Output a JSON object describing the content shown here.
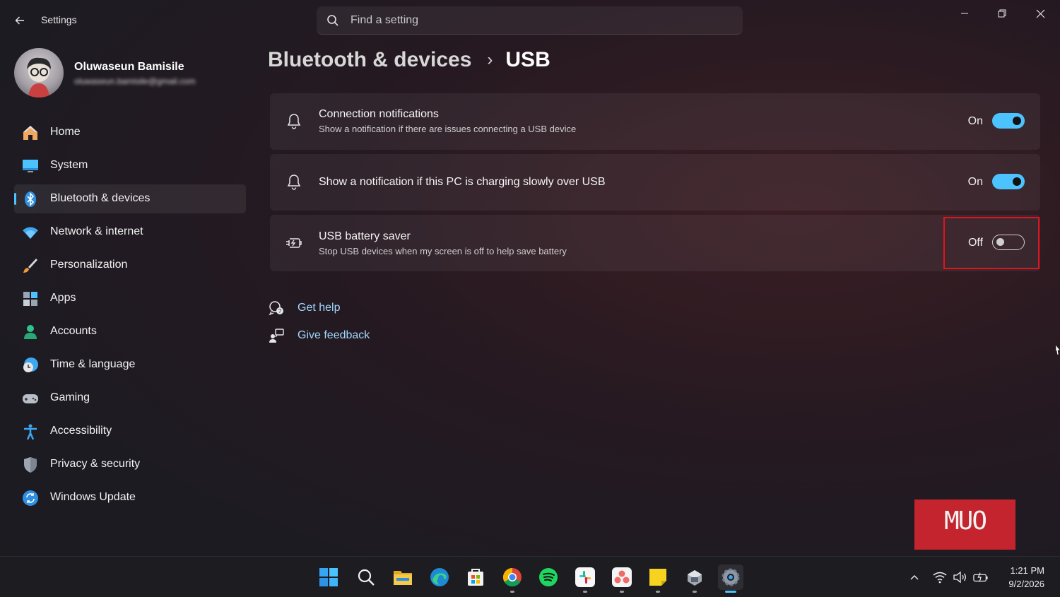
{
  "window": {
    "title": "Settings",
    "search_placeholder": "Find a setting"
  },
  "profile": {
    "name": "Oluwaseun Bamisile",
    "email": "oluwaseun.bamisile@gmail.com"
  },
  "nav": [
    {
      "label": "Home",
      "icon": "home-icon",
      "selected": false
    },
    {
      "label": "System",
      "icon": "system-icon",
      "selected": false
    },
    {
      "label": "Bluetooth & devices",
      "icon": "bluetooth-icon",
      "selected": true
    },
    {
      "label": "Network & internet",
      "icon": "wifi-icon",
      "selected": false
    },
    {
      "label": "Personalization",
      "icon": "brush-icon",
      "selected": false
    },
    {
      "label": "Apps",
      "icon": "apps-icon",
      "selected": false
    },
    {
      "label": "Accounts",
      "icon": "person-icon",
      "selected": false
    },
    {
      "label": "Time & language",
      "icon": "clock-globe-icon",
      "selected": false
    },
    {
      "label": "Gaming",
      "icon": "gamepad-icon",
      "selected": false
    },
    {
      "label": "Accessibility",
      "icon": "accessibility-icon",
      "selected": false
    },
    {
      "label": "Privacy & security",
      "icon": "shield-icon",
      "selected": false
    },
    {
      "label": "Windows Update",
      "icon": "update-icon",
      "selected": false
    }
  ],
  "breadcrumb": {
    "parent": "Bluetooth & devices",
    "separator": "›",
    "current": "USB"
  },
  "settings": [
    {
      "title": "Connection notifications",
      "description": "Show a notification if there are issues connecting a USB device",
      "state_label": "On",
      "enabled": true,
      "icon": "bell-icon"
    },
    {
      "title": "Show a notification if this PC is charging slowly over USB",
      "description": "",
      "state_label": "On",
      "enabled": true,
      "icon": "bell-icon"
    },
    {
      "title": "USB battery saver",
      "description": "Stop USB devices when my screen is off to help save battery",
      "state_label": "Off",
      "enabled": false,
      "icon": "battery-plug-icon"
    }
  ],
  "links": {
    "help": "Get help",
    "feedback": "Give feedback"
  },
  "watermark": "MUO",
  "taskbar": {
    "apps": [
      "start-icon",
      "search-icon",
      "file-explorer-icon",
      "edge-icon",
      "store-icon",
      "chrome-icon",
      "spotify-icon",
      "slack-icon",
      "asana-icon",
      "sticky-notes-icon",
      "vm-icon",
      "settings-icon"
    ],
    "time": "1:21 PM",
    "date": "9/2/2026"
  },
  "colors": {
    "accent": "#4cc2ff",
    "highlight": "#e0141e",
    "watermark_bg": "#c4242e"
  }
}
